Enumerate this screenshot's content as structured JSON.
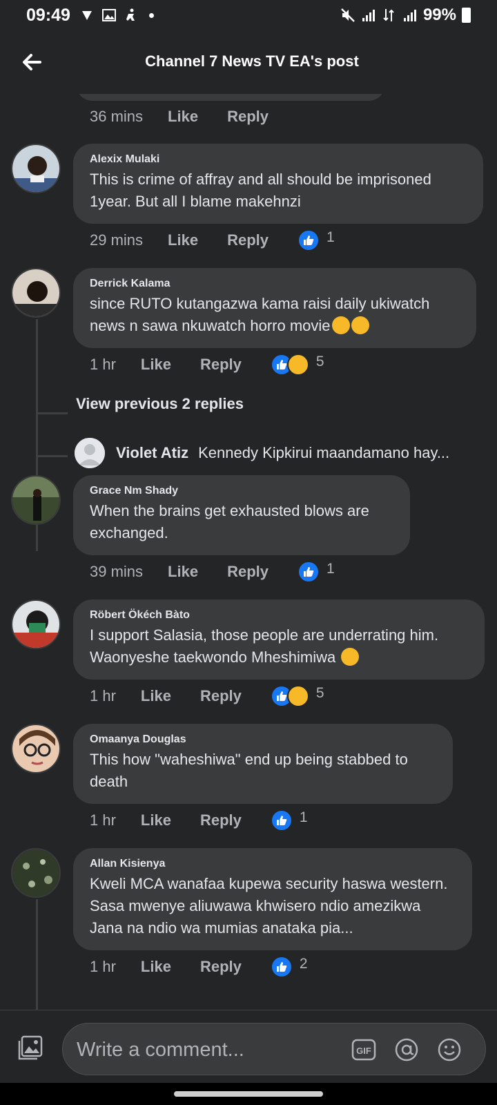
{
  "status_bar": {
    "time": "09:49",
    "battery": "99%"
  },
  "header": {
    "title": "Channel 7 News TV EA's post"
  },
  "actions": {
    "like": "Like",
    "reply": "Reply"
  },
  "first_meta": {
    "time": "36 mins"
  },
  "comments": [
    {
      "name": "Alexix Mulaki",
      "text": "This is crime of affray and all should be imprisoned 1year. But all I blame makehnzi",
      "time": "29 mins",
      "reaction_count": "1"
    },
    {
      "name": "Derrick Kalama",
      "text": "since RUTO kutangazwa kama raisi daily ukiwatch news n sawa nkuwatch horro movie",
      "time": "1 hr",
      "reaction_count": "5"
    },
    {
      "name": "Grace Nm Shady",
      "text": "When the brains get exhausted blows are exchanged.",
      "time": "39 mins",
      "reaction_count": "1"
    },
    {
      "name": "Röbert Ökéch Bàto",
      "text": "I support Salasia, those people are underrating him. Waonyeshe taekwondo Mheshimiwa",
      "time": "1 hr",
      "reaction_count": "5"
    },
    {
      "name": "Omaanya Douglas",
      "text": "This how \"waheshiwa\" end up being stabbed to death",
      "time": "1 hr",
      "reaction_count": "1"
    },
    {
      "name": "Allan Kisienya",
      "text": "Kweli MCA wanafaa kupewa security haswa western. Sasa mwenye aliuwawa khwisero ndio amezikwa Jana na ndio wa mumias anataka pia...",
      "time": "1 hr",
      "reaction_count": "2"
    }
  ],
  "thread": {
    "view_previous": "View previous 2 replies",
    "reply_name": "Violet Atiz",
    "reply_text": "Kennedy Kipkirui maandamano  hay..."
  },
  "composer": {
    "placeholder": "Write a comment...",
    "gif_label": "GIF"
  },
  "colors": {
    "background": "#242526",
    "bubble": "#3a3b3c",
    "like_blue": "#1877f2",
    "haha_yellow": "#f7b928"
  }
}
